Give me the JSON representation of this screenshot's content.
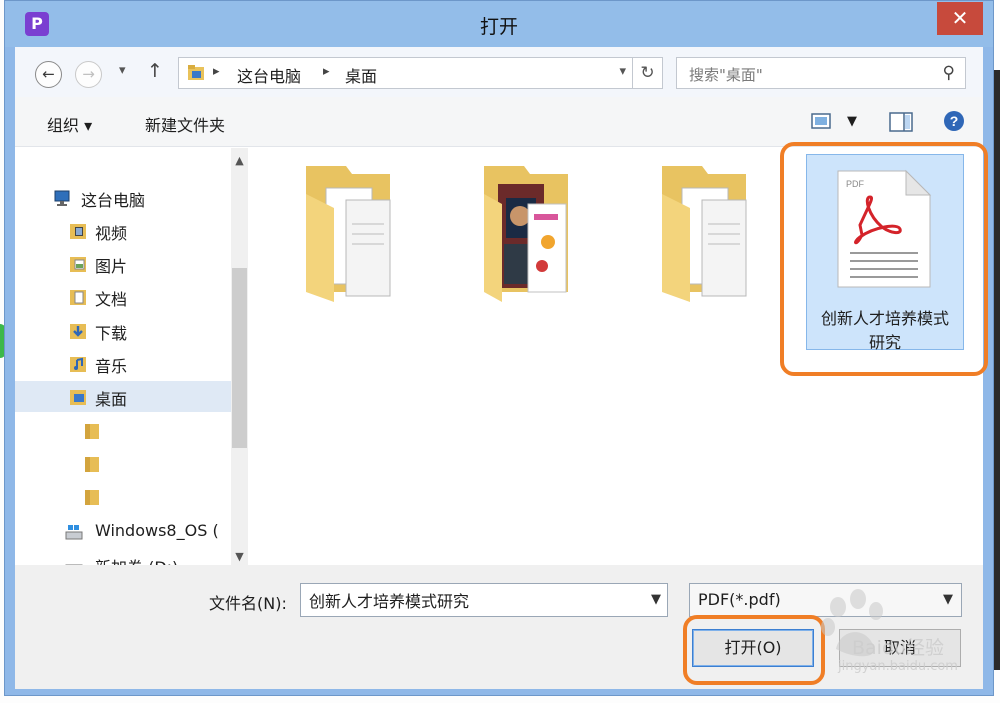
{
  "window": {
    "title": "打开",
    "app_icon": "P",
    "close_glyph": "✕"
  },
  "nav": {
    "back_glyph": "←",
    "forward_glyph": "→",
    "up_glyph": "↑",
    "breadcrumbs": [
      "这台电脑",
      "桌面"
    ],
    "refresh_glyph": "↻",
    "search_placeholder": "搜索\"桌面\""
  },
  "toolbar": {
    "organize_label": "组织 ▾",
    "new_folder_label": "新建文件夹"
  },
  "sidebar": {
    "items": [
      {
        "label": "这台电脑",
        "icon": "computer-icon"
      },
      {
        "label": "视频",
        "icon": "video-folder-icon"
      },
      {
        "label": "图片",
        "icon": "picture-folder-icon"
      },
      {
        "label": "文档",
        "icon": "document-folder-icon"
      },
      {
        "label": "下载",
        "icon": "download-folder-icon"
      },
      {
        "label": "音乐",
        "icon": "music-folder-icon"
      },
      {
        "label": "桌面",
        "icon": "desktop-folder-icon",
        "selected": true
      },
      {
        "label": "",
        "icon": "folder-icon"
      },
      {
        "label": "",
        "icon": "folder-icon"
      },
      {
        "label": "",
        "icon": "folder-icon"
      },
      {
        "label": "Windows8_OS (",
        "icon": "drive-icon"
      },
      {
        "label": "新加卷 (D:)",
        "icon": "drive-icon"
      }
    ]
  },
  "files": [
    {
      "label": "",
      "icon": "folder-documents-icon"
    },
    {
      "label": "",
      "icon": "folder-photos-icon"
    },
    {
      "label": "",
      "icon": "folder-documents-icon"
    },
    {
      "label": "创新人才培养模式研究",
      "icon": "pdf-file-icon",
      "selected": true
    }
  ],
  "pdf_icon_text": "PDF",
  "bottom": {
    "filename_label": "文件名(N):",
    "filename_value": "创新人才培养模式研究",
    "filetype_value": "PDF(*.pdf)",
    "open_label": "打开(O)",
    "cancel_label": "取消"
  },
  "watermark": {
    "brand": "Baidu经验",
    "url": "jingyan.baidu.com"
  },
  "colors": {
    "highlight": "#f07e26",
    "title_bar": "#93bde9",
    "selection": "#cde4fb",
    "close": "#c74a3c"
  }
}
